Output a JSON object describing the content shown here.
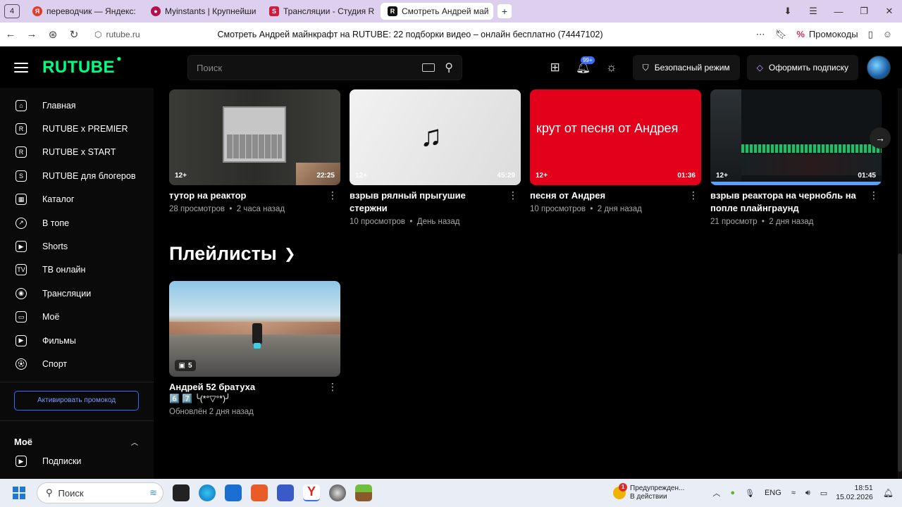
{
  "browser": {
    "tab_counter": "4",
    "tabs": [
      {
        "label": "переводчик — Яндекс: на",
        "fav_color": "#e33a2c",
        "fav_text": "Я"
      },
      {
        "label": "Myinstants | Крупнейший",
        "fav_color": "#b2124a",
        "fav_text": "●"
      },
      {
        "label": "Трансляции - Студия RU",
        "fav_color": "#d21c3c",
        "fav_text": "S"
      },
      {
        "label": "Смотреть Андрей май",
        "fav_color": "#111111",
        "fav_text": "R",
        "active": true
      }
    ],
    "new_tab": "+",
    "window_controls": [
      "⬇",
      "☰",
      "—",
      "❐",
      "✕"
    ],
    "url": "rutube.ru",
    "page_title": "Смотреть Андрей майнкрафт на RUTUBE: 22 подборки видео – онлайн бесплатно (74447102)",
    "promo_label": "Промокоды"
  },
  "header": {
    "logo": "RUTUBE",
    "search_placeholder": "Поиск",
    "notif_badge": "99+",
    "safe_mode": "Безопасный режим",
    "subscribe": "Оформить подписку"
  },
  "sidebar": {
    "items": [
      {
        "label": "Главная",
        "icon": "home-icon"
      },
      {
        "label": "RUTUBE x PREMIER",
        "icon": "premier-icon"
      },
      {
        "label": "RUTUBE x START",
        "icon": "start-icon"
      },
      {
        "label": "RUTUBE для блогеров",
        "icon": "blogger-icon"
      },
      {
        "label": "Каталог",
        "icon": "catalog-icon"
      },
      {
        "label": "В топе",
        "icon": "fire-icon"
      },
      {
        "label": "Shorts",
        "icon": "shorts-icon"
      },
      {
        "label": "ТВ онлайн",
        "icon": "tv-icon"
      },
      {
        "label": "Трансляции",
        "icon": "broadcast-icon"
      },
      {
        "label": "Моё",
        "icon": "my-icon"
      },
      {
        "label": "Фильмы",
        "icon": "film-icon"
      },
      {
        "label": "Спорт",
        "icon": "sport-icon"
      }
    ],
    "promo_button": "Активировать промокод",
    "section_title": "Моё",
    "subscriptions": "Подписки"
  },
  "videos": [
    {
      "title": "тутор на реактор",
      "views": "28 просмотров",
      "ago": "2 часа назад",
      "age": "12+",
      "duration": "22:25"
    },
    {
      "title": "взрыв рялный прыгушие стержни",
      "views": "10 просмотров",
      "ago": "День назад",
      "age": "12+",
      "duration": "45:29"
    },
    {
      "title": "песня от Андрея",
      "views": "10 просмотров",
      "ago": "2 дня назад",
      "age": "12+",
      "duration": "01:36",
      "thumb_text": "крут от песня от Андрея"
    },
    {
      "title": "взрыв реактора на чернобль на попле плайнграунд",
      "views": "21 просмотр",
      "ago": "2 дня назад",
      "age": "12+",
      "duration": "01:45"
    }
  ],
  "playlists": {
    "title": "Плейлисты",
    "items": [
      {
        "title": "Андрей 52 братуха",
        "subtitle": "6️⃣ 7️⃣ ╰(*°▽°*)╯",
        "updated": "Обновлён 2 дня назад",
        "count": "5"
      }
    ]
  },
  "taskbar": {
    "search": "Поиск",
    "notification_title": "Предупрежден...",
    "notification_sub": "В действии",
    "notification_count": "1",
    "lang": "ENG",
    "time": "18:51",
    "date": "15.02.2026"
  }
}
